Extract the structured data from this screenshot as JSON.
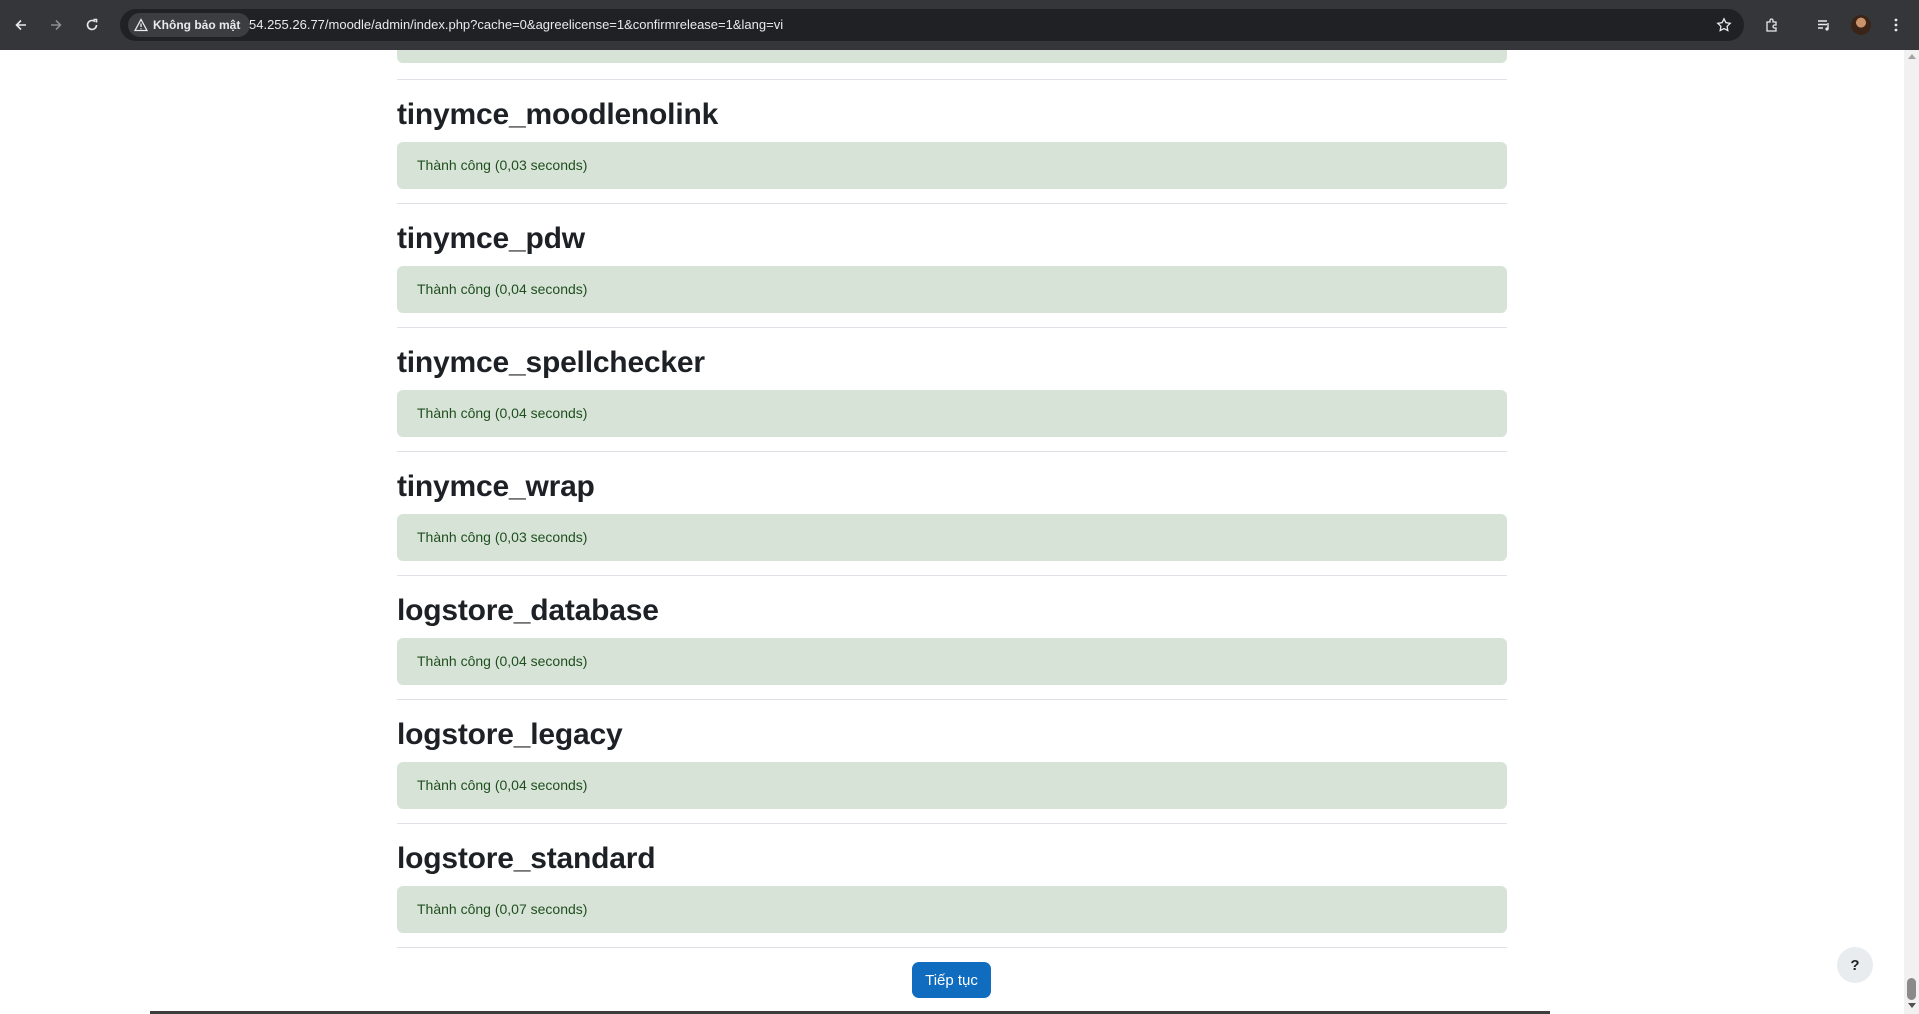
{
  "browser": {
    "security_label": "Không bảo mật",
    "url": "54.255.26.77/moodle/admin/index.php?cache=0&agreelicense=1&confirmrelease=1&lang=vi"
  },
  "plugins": [
    {
      "name": "tinymce_moodlenolink",
      "status": "Thành công (0,03 seconds)"
    },
    {
      "name": "tinymce_pdw",
      "status": "Thành công (0,04 seconds)"
    },
    {
      "name": "tinymce_spellchecker",
      "status": "Thành công (0,04 seconds)"
    },
    {
      "name": "tinymce_wrap",
      "status": "Thành công (0,03 seconds)"
    },
    {
      "name": "logstore_database",
      "status": "Thành công (0,04 seconds)"
    },
    {
      "name": "logstore_legacy",
      "status": "Thành công (0,04 seconds)"
    },
    {
      "name": "logstore_standard",
      "status": "Thành công (0,07 seconds)"
    }
  ],
  "actions": {
    "continue_label": "Tiếp tục",
    "help_label": "?"
  },
  "colors": {
    "success_bg": "#d7e3d7",
    "primary_button": "#0f6cbf",
    "chrome_bg": "#35363a"
  }
}
